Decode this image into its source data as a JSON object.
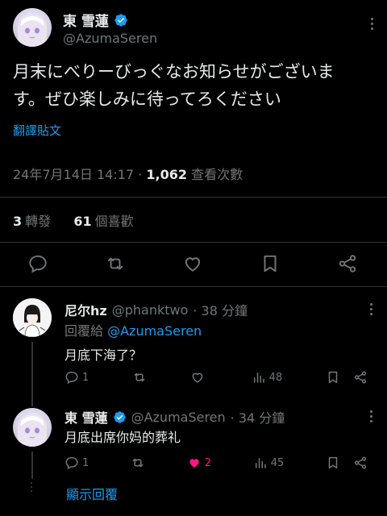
{
  "main_tweet": {
    "author_name": "東 雪蓮",
    "author_handle": "@AzumaSeren",
    "text_line1": "月末にべりーびっぐなお知らせがございま",
    "text_line2": "す。ぜひ楽しみに待ってろください",
    "translate_label": "翻譯貼文",
    "timestamp": "24年7月14日 14:17",
    "separator": "·",
    "views_count": "1,062",
    "views_label": "查看次數",
    "reposts_count": "3",
    "reposts_label": "轉發",
    "likes_count": "61",
    "likes_label": "個喜歡"
  },
  "reply1": {
    "author_name": "尼尔hz",
    "author_handle": "@phanktwo",
    "time": "· 38 分鐘",
    "reply_to_label": "回覆給",
    "reply_to_handle": "@AzumaSeren",
    "text": "月底下海了？",
    "reply_count": "1",
    "like_count": "",
    "views_count": "48"
  },
  "reply2": {
    "author_name": "東 雪蓮",
    "author_handle": "@AzumaSeren",
    "time": "· 34 分鐘",
    "text": "月底出席你妈的葬礼",
    "reply_count": "1",
    "like_count": "2",
    "views_count": "45"
  },
  "show_replies_label": "顯示回覆",
  "colors": {
    "background": "#000000",
    "text": "#e7e9ea",
    "secondary": "#71767b",
    "link": "#1d9bf0",
    "verified": "#1d9bf0",
    "liked": "#f91880"
  }
}
